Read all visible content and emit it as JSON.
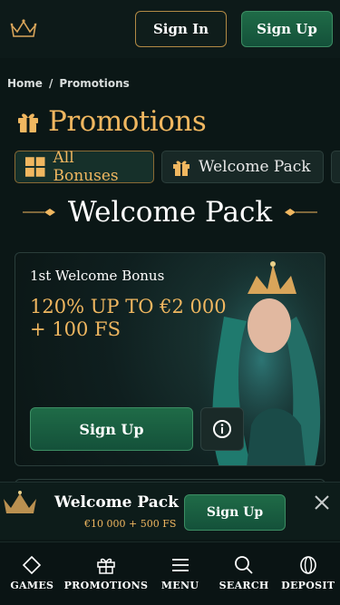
{
  "header": {
    "logo_icon": "crown-logo-icon",
    "signin_label": "Sign In",
    "signup_label": "Sign Up"
  },
  "breadcrumb": {
    "home": "Home",
    "separator": "/",
    "current": "Promotions"
  },
  "page": {
    "title": "Promotions",
    "title_icon": "gift-icon",
    "accent_color": "#f0b760"
  },
  "tabs": [
    {
      "label": "All Bonuses",
      "icon": "grid-icon",
      "active": true
    },
    {
      "label": "Welcome Pack",
      "icon": "gift-box-icon",
      "active": false
    }
  ],
  "section": {
    "title": "Welcome Pack"
  },
  "card": {
    "subtitle": "1st Welcome Bonus",
    "headline": "120% UP TO €2 000 + 100 FS",
    "signup_label": "Sign Up",
    "info_icon": "info-icon"
  },
  "banner": {
    "title": "Welcome Pack",
    "subtitle": "€10 000 + 500 FS",
    "signup_label": "Sign Up",
    "close_icon": "close-icon"
  },
  "nav": [
    {
      "label": "GAMES",
      "icon": "diamond-icon"
    },
    {
      "label": "PROMOTIONS",
      "icon": "gift-icon"
    },
    {
      "label": "MENU",
      "icon": "menu-icon"
    },
    {
      "label": "SEARCH",
      "icon": "search-icon"
    },
    {
      "label": "DEPOSIT",
      "icon": "coin-icon"
    }
  ]
}
